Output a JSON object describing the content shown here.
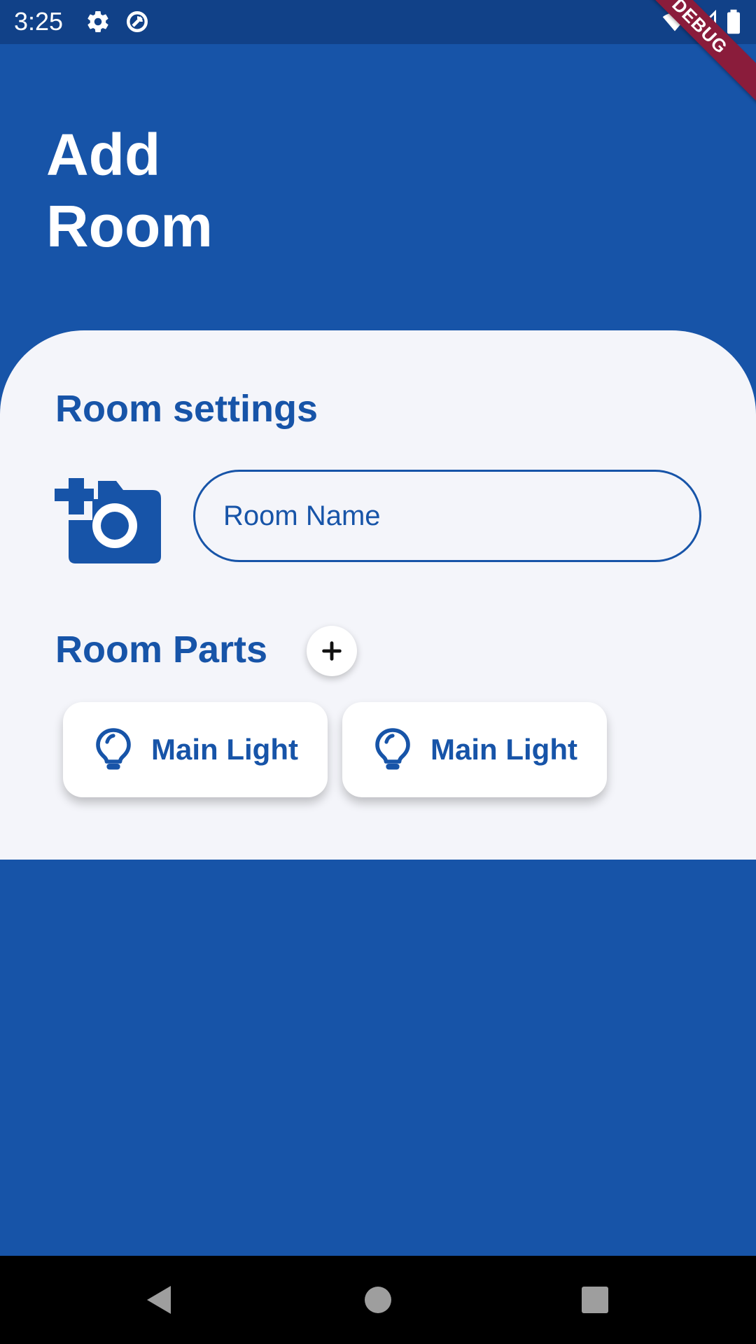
{
  "status_bar": {
    "time": "3:25",
    "icons": [
      "gear-icon",
      "data-saver-icon",
      "wifi-icon",
      "signal-icon",
      "battery-icon"
    ]
  },
  "debug_banner": {
    "label": "DEBUG",
    "color": "#8a1c3b"
  },
  "header": {
    "title": "Add\nRoom"
  },
  "room_settings": {
    "title": "Room settings",
    "add_photo_icon": "add-a-photo-icon",
    "room_name": {
      "value": "",
      "placeholder": "Room Name"
    }
  },
  "room_parts": {
    "title": "Room Parts",
    "add_icon": "plus-icon",
    "items": [
      {
        "label": "Main Light",
        "icon": "lightbulb-icon"
      },
      {
        "label": "Main Light",
        "icon": "lightbulb-icon"
      }
    ]
  },
  "nav_bar": {
    "buttons": [
      "back-triangle-icon",
      "home-circle-icon",
      "recents-square-icon"
    ]
  },
  "colors": {
    "primary": "#1754a8",
    "status_bar": "#114188",
    "card_background": "#f4f5fa",
    "nav_bar": "#000000",
    "nav_icon": "#9e9e9e"
  }
}
